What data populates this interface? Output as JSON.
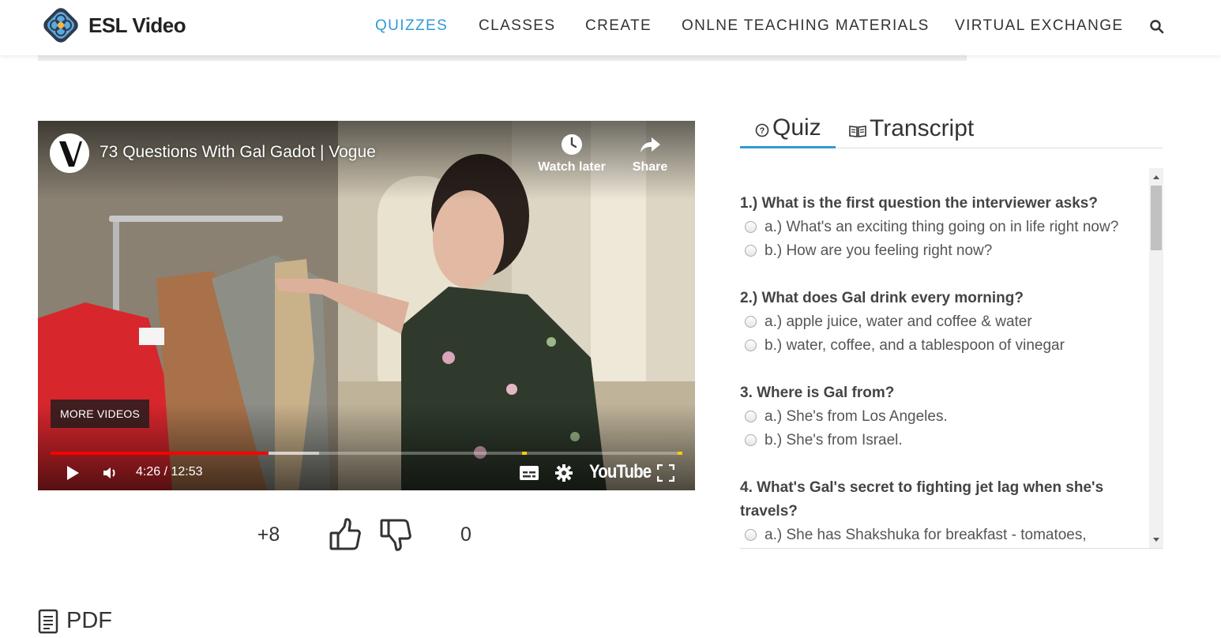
{
  "brand": {
    "name": "ESL Video"
  },
  "nav": {
    "items": [
      {
        "label": "QUIZZES",
        "active": true
      },
      {
        "label": "CLASSES",
        "active": false
      },
      {
        "label": "CREATE",
        "active": false
      },
      {
        "label": "ONLNE TEACHING MATERIALS",
        "active": false
      },
      {
        "label": "VIRTUAL EXCHANGE",
        "active": false
      }
    ],
    "search_icon": "search-icon"
  },
  "video": {
    "title": "73 Questions With Gal Gadot | Vogue",
    "watch_later_label": "Watch later",
    "share_label": "Share",
    "more_videos_label": "MORE VIDEOS",
    "time_display": "4:26 / 12:53",
    "progress_played_fraction": 0.345,
    "progress_loaded_fraction": 0.425,
    "youtube_label": "YouTube"
  },
  "votes": {
    "up_count": "+8",
    "down_count": "0"
  },
  "pdf": {
    "label": "PDF"
  },
  "tabs": [
    {
      "label": "Quiz",
      "active": true,
      "icon": "question-circle-icon"
    },
    {
      "label": "Transcript",
      "active": false,
      "icon": "open-book-icon"
    }
  ],
  "quiz": {
    "questions": [
      {
        "text": "1.) What is the first question the interviewer asks?",
        "options": [
          "a.) What's an exciting thing going on in life right now?",
          "b.) How are you feeling right now?"
        ]
      },
      {
        "text": "2.) What does Gal drink every morning?",
        "options": [
          "a.) apple juice, water and coffee & water",
          "b.) water, coffee, and a tablespoon of vinegar"
        ]
      },
      {
        "text": "3. Where is Gal from?",
        "options": [
          "a.) She's from Los Angeles.",
          "b.) She's from Israel."
        ]
      },
      {
        "text_line1": "4. What's Gal's secret to fighting jet lag when she's",
        "text_line2": "travels?",
        "options": [
          "a.) She has Shakshuka for breakfast - tomatoes,"
        ]
      }
    ]
  },
  "colors": {
    "accent": "#2e9bd6",
    "progress_red": "#ff0000",
    "marker_yellow": "#ffcc00"
  }
}
